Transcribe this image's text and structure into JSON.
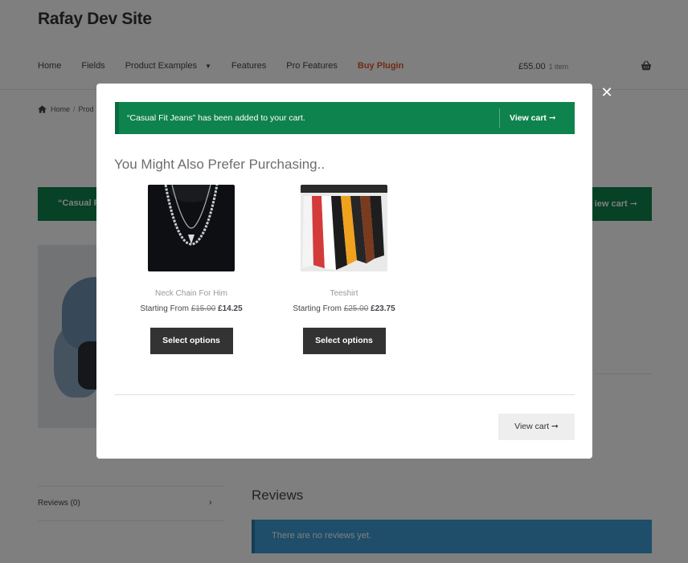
{
  "site": {
    "title": "Rafay Dev Site",
    "nav": [
      {
        "label": "Home"
      },
      {
        "label": "Fields"
      },
      {
        "label": "Product Examples",
        "has_dropdown": true
      },
      {
        "label": "Features"
      },
      {
        "label": "Pro Features"
      },
      {
        "label": "Buy Plugin",
        "highlight_color": "#e0542a"
      }
    ],
    "cart_total": "£55.00",
    "cart_count": "1 item",
    "cart_icon": "basket-icon"
  },
  "breadcrumb": {
    "home": "Home",
    "next": "Prod",
    "separator": "/"
  },
  "background_notice": {
    "message": "“Casual Fi",
    "view_cart": "iew cart ➞"
  },
  "reviews": {
    "tab_label": "Reviews (0)",
    "chevron": "›",
    "heading": "Reviews",
    "empty_message": "There are no reviews yet."
  },
  "modal": {
    "close": "✕",
    "notice": {
      "message": "“Casual Fit Jeans” has been added to your cart.",
      "view_cart": "View cart ➞",
      "color": "#0f834d"
    },
    "heading": "You Might Also Prefer Purchasing..",
    "products": [
      {
        "name": "Neck Chain For Him",
        "price_prefix": "Starting From",
        "regular_price": "£15.00",
        "sale_price": "£14.25",
        "button": "Select options"
      },
      {
        "name": "Teeshirt",
        "price_prefix": "Starting From",
        "regular_price": "£25.00",
        "sale_price": "£23.75",
        "button": "Select options"
      }
    ],
    "view_cart_button": "View cart ➞"
  }
}
